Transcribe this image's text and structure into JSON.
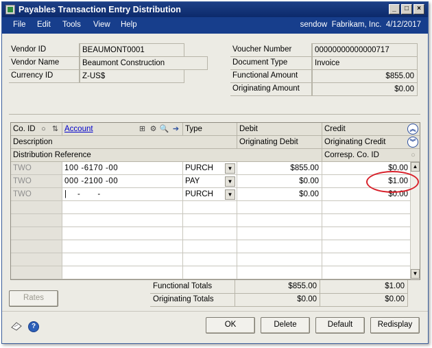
{
  "window": {
    "title": "Payables Transaction Entry Distribution",
    "min_glyph": "_",
    "max_glyph": "□",
    "close_glyph": "×"
  },
  "menu": {
    "items": [
      "File",
      "Edit",
      "Tools",
      "View",
      "Help"
    ],
    "user_info": "sendow  Fabrikam, Inc.  4/12/2017"
  },
  "header_fields": {
    "vendor_id": {
      "label": "Vendor ID",
      "value": "BEAUMONT0001"
    },
    "vendor_name": {
      "label": "Vendor Name",
      "value": "Beaumont Construction"
    },
    "currency_id": {
      "label": "Currency ID",
      "value": "Z-US$"
    },
    "voucher_number": {
      "label": "Voucher Number",
      "value": "00000000000000717"
    },
    "document_type": {
      "label": "Document Type",
      "value": "Invoice"
    },
    "functional_amount": {
      "label": "Functional Amount",
      "value": "$855.00"
    },
    "originating_amount": {
      "label": "Originating Amount",
      "value": "$0.00"
    }
  },
  "grid": {
    "headers": {
      "co_id": "Co. ID",
      "account": "Account",
      "type": "Type",
      "debit": "Debit",
      "credit": "Credit",
      "description": "Description",
      "originating_debit": "Originating Debit",
      "originating_credit": "Originating Credit",
      "distribution_reference": "Distribution Reference",
      "corresp_co_id": "Corresp. Co. ID"
    },
    "rows": [
      {
        "co": "TWO",
        "account": "100 -6170 -00",
        "type": "PURCH",
        "debit": "$855.00",
        "credit": "$0.00"
      },
      {
        "co": "TWO",
        "account": "000 -2100 -00",
        "type": "PAY",
        "debit": "$0.00",
        "credit": "$1.00"
      },
      {
        "co": "TWO",
        "account": "|     -        -",
        "type": "PURCH",
        "debit": "$0.00",
        "credit": "$0.00"
      }
    ]
  },
  "totals": {
    "functional_label": "Functional Totals",
    "functional_debit": "$855.00",
    "functional_credit": "$1.00",
    "originating_label": "Originating Totals",
    "originating_debit": "$0.00",
    "originating_credit": "$0.00"
  },
  "buttons": {
    "rates": "Rates",
    "ok": "OK",
    "delete": "Delete",
    "default": "Default",
    "redisplay": "Redisplay"
  },
  "icons": {
    "help": "?",
    "expand_up": "︽",
    "expand_down": "︾"
  },
  "colors": {
    "title_bar": "#1d3f86",
    "menu_bar": "#173e8c",
    "form_background": "#ecebe4",
    "link": "#0000cc",
    "callout": "#d8202a"
  }
}
